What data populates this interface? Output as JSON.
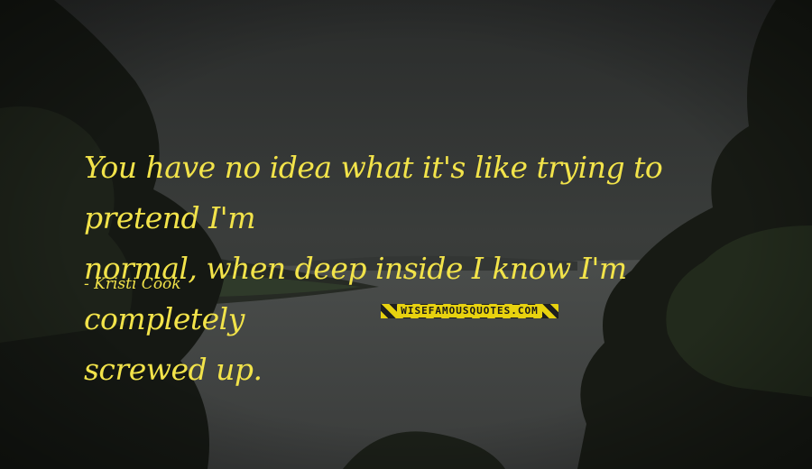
{
  "quote": {
    "text": "You have no idea what it's like trying to pretend I'm\nnormal, when deep inside I know I'm completely\nscrewed up."
  },
  "author": {
    "name": "- Kristi Cook"
  },
  "watermark": {
    "text": "WISEFAMOUSQUOTES.COM"
  },
  "colors": {
    "quote_text": "#f2e34a",
    "watermark_yellow": "#e8d20f",
    "background": "#2b2d2c"
  }
}
